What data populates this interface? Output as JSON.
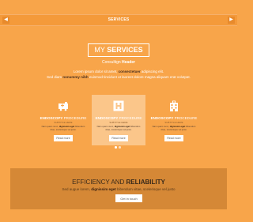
{
  "nav": {
    "title": "SERVICES",
    "prev_icon": "chevron-left-icon",
    "next_icon": "chevron-right-icon"
  },
  "heading": {
    "light": "MY",
    "bold": "SERVICES"
  },
  "consult": {
    "light": "Consultign",
    "bold": "Header"
  },
  "intro": {
    "line1_a": "Lorem ipsum dolor sit amet,",
    "line1_b": "consectetuer",
    "line1_c": "adipiscing elit.",
    "line2_a": "Sed diam",
    "line2_b": "nonummy nibh",
    "line2_c": "euismod tincidunt ut laoreet dolore magna aliquam erat volutpat."
  },
  "cards": [
    {
      "icon": "ambulance-icon",
      "title_bold": "ENDOSCOPY",
      "title_light": "PROCEDURE",
      "sub": "SUBTITLE HERE",
      "desc_a": "Nam quam nunc,",
      "desc_b": "dignissim eget",
      "desc_c": "bibendum vitae, scelerisque vel justo.",
      "button": "Read more"
    },
    {
      "icon": "hospital-sign-icon",
      "title_bold": "ENDOSCOPY",
      "title_light": "PROCEDURE",
      "sub": "SUBTITLE HERE",
      "desc_a": "Nam quam nunc,",
      "desc_b": "dignissim eget",
      "desc_c": "bibendum vitae, scelerisque vel justo.",
      "button": "Read more"
    },
    {
      "icon": "hospital-building-icon",
      "title_bold": "ENDOSCOPY",
      "title_light": "PROCEDURE",
      "sub": "SUBTITLE HERE",
      "desc_a": "Nam quam nunc,",
      "desc_b": "dignissim eget",
      "desc_c": "bibendum vitae, scelerisque vel justo.",
      "button": "Read more"
    }
  ],
  "carousel": {
    "active_index": 0,
    "count": 2
  },
  "band": {
    "title_light": "EFFICIENCY AND",
    "title_bold": "RELIABILITY",
    "text_a": "Sed augue lorem,",
    "text_b": "dignissim eget",
    "text_c": "bibendum vitae, scelerisque vel justo",
    "button": "Get in touch"
  },
  "colors": {
    "background": "#f8a54a",
    "active_card": "#fbc68a",
    "band": "#d58836"
  }
}
